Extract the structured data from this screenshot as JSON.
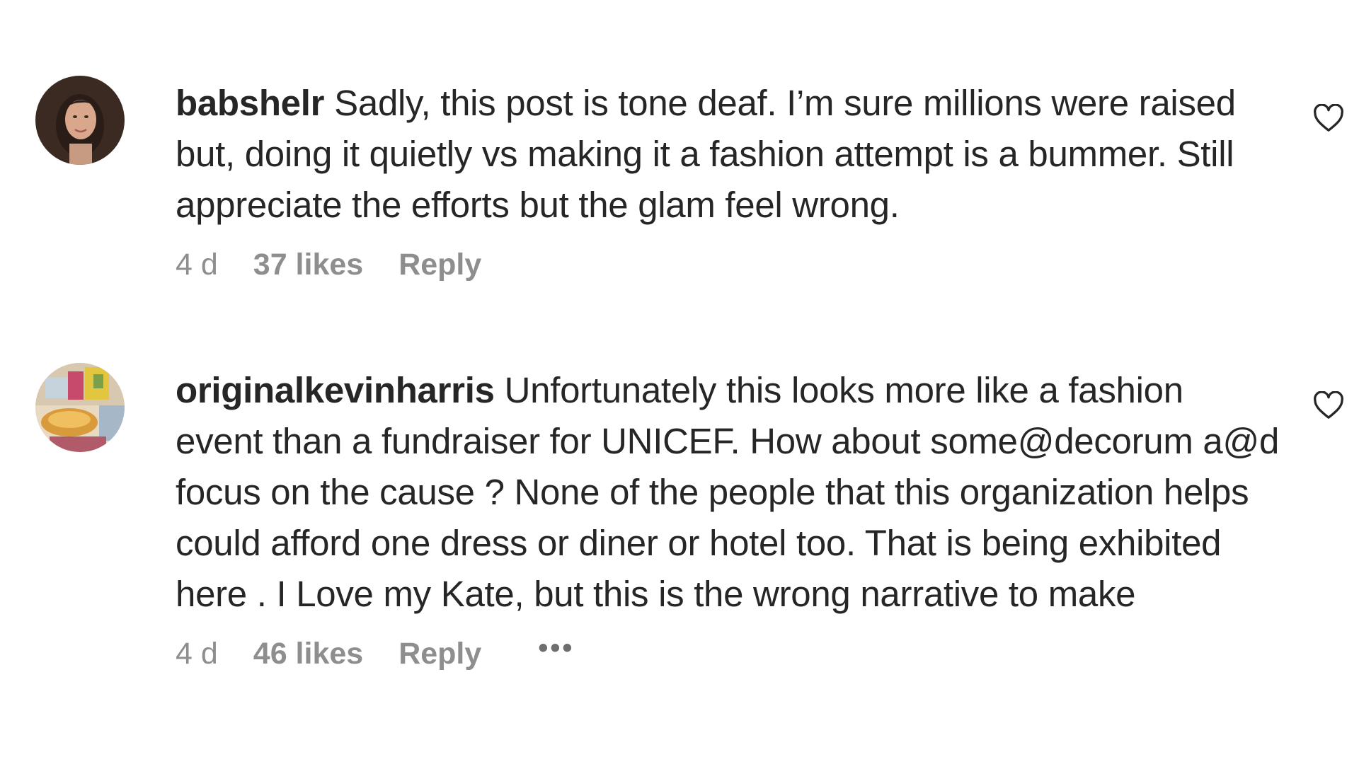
{
  "comments": [
    {
      "username": "babshelr",
      "text": "Sadly, this post is tone deaf. I’m sure millions were raised but, doing it quietly vs making it a fashion attempt is a bummer. Still appreciate the efforts but the glam feel wrong.",
      "time": "4 d",
      "likes": "37 likes",
      "reply_label": "Reply",
      "avatar_icon": "profile-photo-woman"
    },
    {
      "username": "originalkevinharris",
      "text": "Unfortunately this looks more like a fashion event than a fundraiser for UNICEF. How about some@decorum a@d focus on the cause ? None of the people that this organization helps could afford one dress or diner or hotel too. That is being exhibited here . I Love my Kate, but this is the wrong narrative to make",
      "time": "4 d",
      "likes": "46 likes",
      "reply_label": "Reply",
      "more_label": "•••",
      "avatar_icon": "profile-photo-colorful"
    }
  ],
  "icons": {
    "like": "heart-outline-icon",
    "more": "ellipsis-icon"
  },
  "colors": {
    "text": "#262626",
    "meta": "#8e8e8e",
    "background": "#ffffff"
  }
}
